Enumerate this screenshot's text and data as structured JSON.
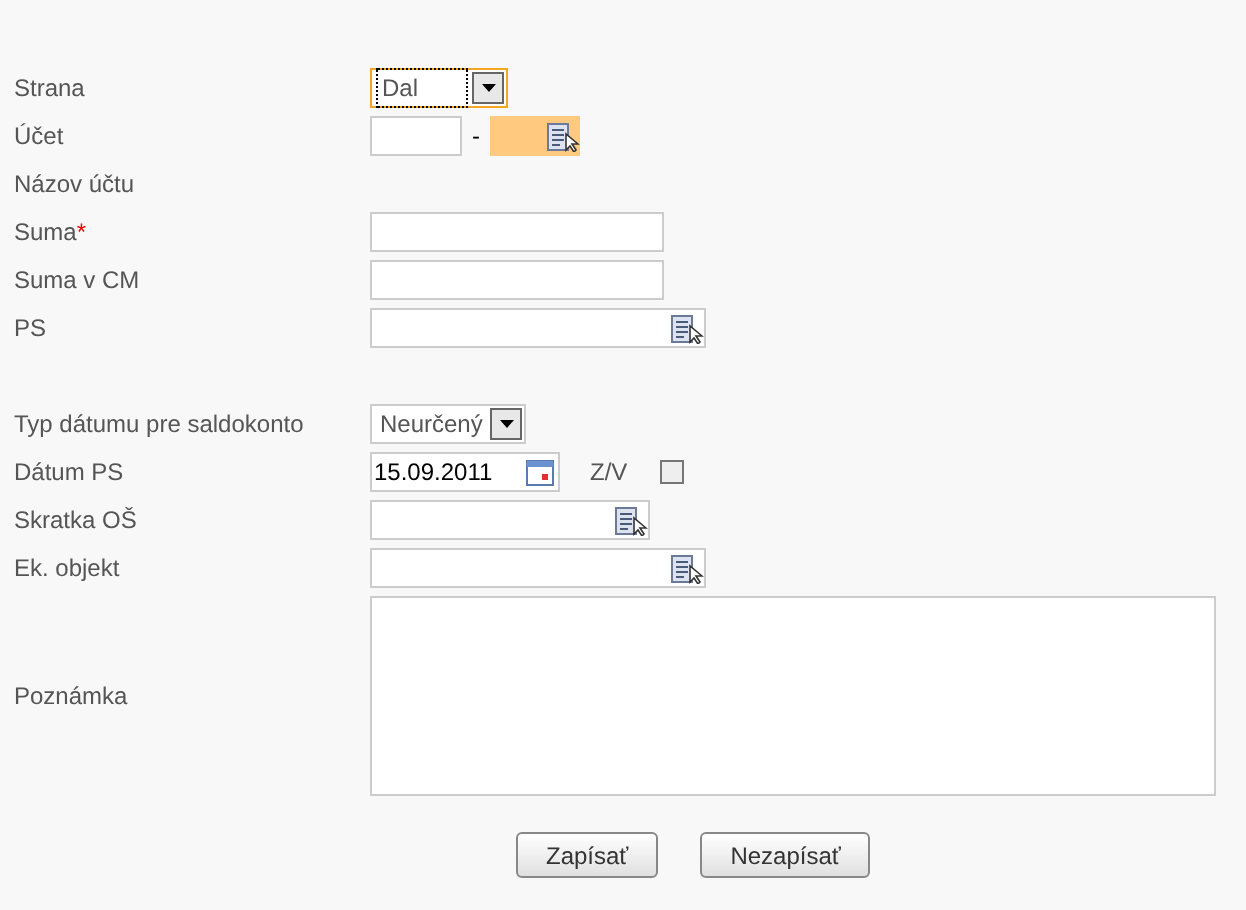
{
  "rows": [
    {
      "kind": "select",
      "label": "Strana",
      "value": "Dal",
      "focused": true
    },
    {
      "kind": "account",
      "label": "Účet",
      "separator": "-",
      "highlighted": true
    },
    {
      "kind": "label",
      "label": "Názov účtu"
    },
    {
      "kind": "input",
      "label": "Suma",
      "required_mark": "*"
    },
    {
      "kind": "input",
      "label": "Suma v CM"
    },
    {
      "kind": "lookup_wide",
      "label": "PS"
    },
    {
      "kind": "spacer"
    },
    {
      "kind": "select",
      "label": "Typ dátumu pre saldokonto",
      "value": "Neurčený",
      "focused": false
    },
    {
      "kind": "date",
      "label": "Dátum PS",
      "value": "15.09.2011",
      "extra_label": "Z/V",
      "checked": false
    },
    {
      "kind": "lookup",
      "label": "Skratka OŠ"
    },
    {
      "kind": "lookup_wide",
      "label": "Ek. objekt"
    },
    {
      "kind": "textarea",
      "label": "Poznámka"
    }
  ],
  "buttons": [
    "Zapísať",
    "Nezapísať"
  ]
}
